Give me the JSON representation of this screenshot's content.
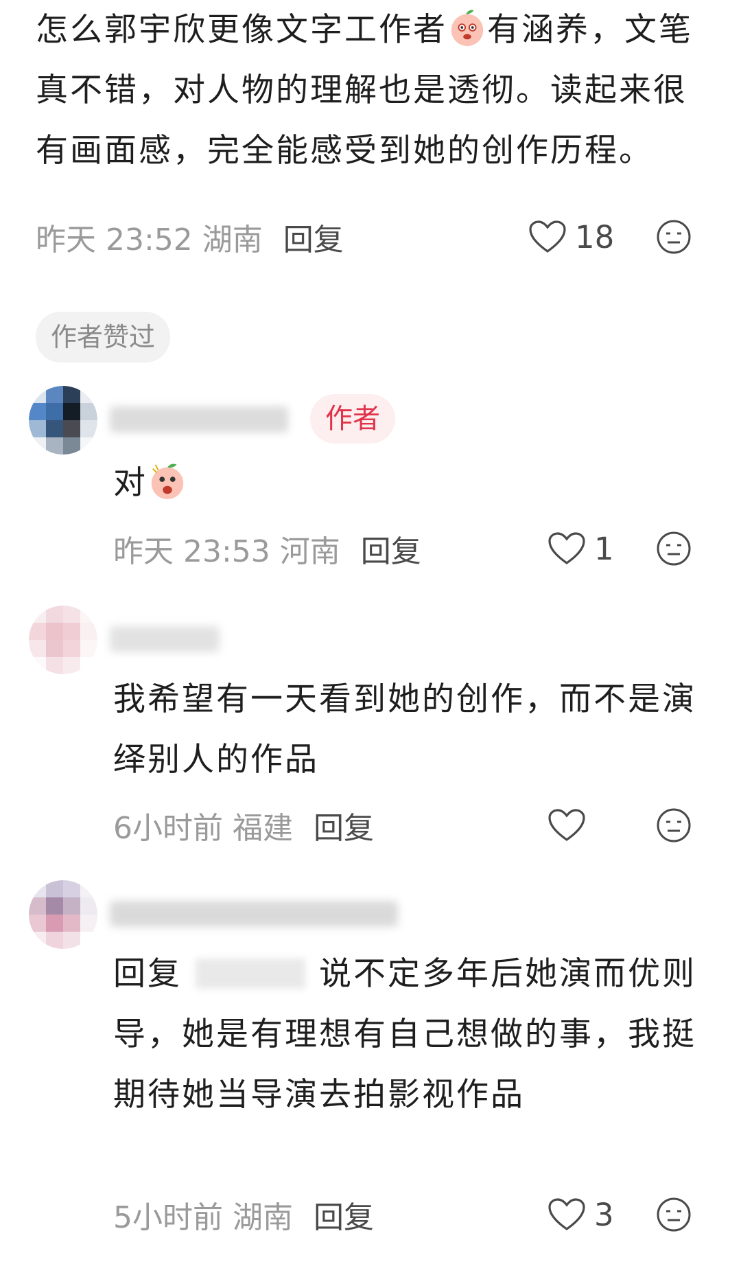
{
  "comments": [
    {
      "text_a": "怎么郭宇欣更像文字工作者",
      "emoji_a": "thinking-peach-emoji",
      "text_b": "有涵养，文笔真不错，对人物的理解也是透彻。读起来很有画面感，完全能感受到她的创作历程。",
      "time": "昨天 23:52",
      "region": "湖南",
      "reply_label": "回复",
      "likes": "18",
      "badge": "作者赞过"
    },
    {
      "author_tag": "作者",
      "text": "对",
      "emoji": "shocked-peach-emoji",
      "time": "昨天 23:53",
      "region": "河南",
      "reply_label": "回复",
      "likes": "1"
    },
    {
      "text": "我希望有一天看到她的创作，而不是演绎别人的作品",
      "time": "6小时前",
      "region": "福建",
      "reply_label": "回复",
      "likes": ""
    },
    {
      "reply_prefix": "回复",
      "text": "说不定多年后她演而优则导，她是有理想有自己想做的事，我挺期待她当导演去拍影视作品",
      "time": "5小时前",
      "region": "湖南",
      "reply_label": "回复",
      "likes": "3"
    }
  ],
  "colors": {
    "author_accent": "#e0344a",
    "meta_gray": "#9a9a9a"
  }
}
